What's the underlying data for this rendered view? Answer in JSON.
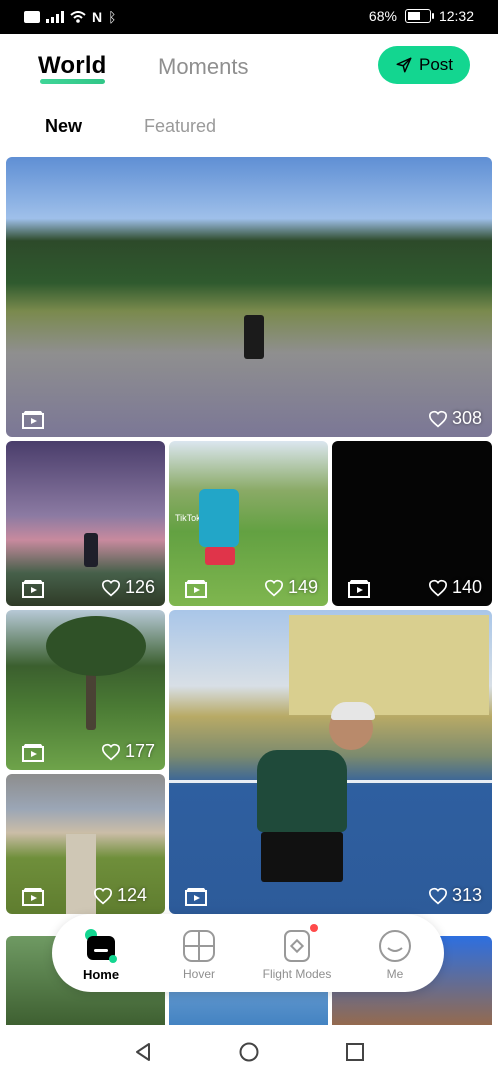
{
  "status_bar": {
    "left_icons": [
      "volte-icon",
      "signal-icon",
      "wifi-icon",
      "nfc-icon",
      "bluetooth-icon"
    ],
    "battery_percent": "68%",
    "battery_level": 0.68,
    "time": "12:32"
  },
  "header": {
    "tab_world": "World",
    "tab_moments": "Moments",
    "post_label": "Post",
    "accent": "#13d690"
  },
  "subtabs": {
    "new": "New",
    "featured": "Featured"
  },
  "feed": {
    "tiles": [
      {
        "likes": "308"
      },
      {
        "likes": "126"
      },
      {
        "likes": "149",
        "watermark": "TikTok"
      },
      {
        "likes": "140"
      },
      {
        "likes": "177"
      },
      {
        "likes": "313"
      },
      {
        "likes": "124"
      }
    ]
  },
  "bottom_nav": {
    "items": [
      {
        "label": "Home",
        "icon": "home-icon",
        "active": true
      },
      {
        "label": "Hover",
        "icon": "hover-icon"
      },
      {
        "label": "Flight Modes",
        "icon": "flight-modes-icon",
        "badge": true
      },
      {
        "label": "Me",
        "icon": "me-icon"
      }
    ]
  },
  "system_nav": [
    "back-icon",
    "home-circle-icon",
    "recents-icon"
  ]
}
